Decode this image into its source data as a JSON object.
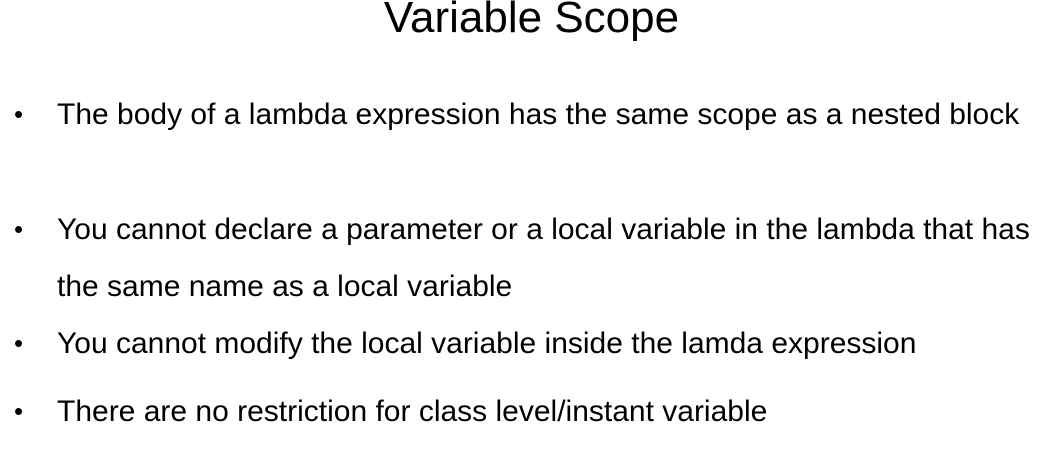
{
  "slide": {
    "title": "Variable Scope",
    "bullet_marker": "•",
    "bullets": [
      {
        "text": "The body of a lambda expression has the same scope as a nested block"
      },
      {
        "text": "You cannot declare a parameter or a local variable in the lambda that has the same name as a local variable"
      },
      {
        "text": "You cannot modify the local variable inside the lamda expression"
      },
      {
        "text": "There are no restriction for class level/instant variable"
      }
    ]
  }
}
